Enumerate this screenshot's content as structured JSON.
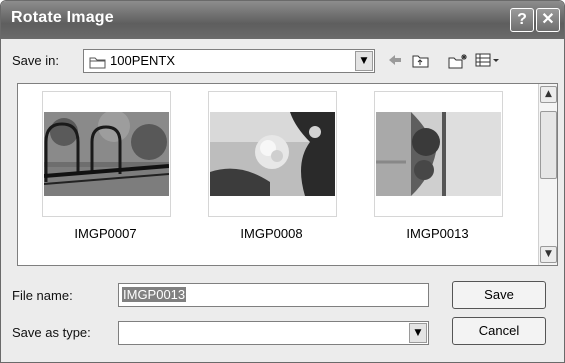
{
  "window": {
    "title": "Rotate Image",
    "help_label": "?",
    "close_label": "✕"
  },
  "save_in": {
    "label": "Save in:",
    "value": "100PENTX"
  },
  "toolbar": {
    "back_icon": "back-arrow-icon",
    "up_icon": "up-folder-icon",
    "new_folder_icon": "new-folder-icon",
    "views_icon": "views-menu-icon"
  },
  "files": [
    {
      "name": "IMGP0007"
    },
    {
      "name": "IMGP0008"
    },
    {
      "name": "IMGP0013"
    }
  ],
  "file_name": {
    "label": "File name:",
    "value": "IMGP0013"
  },
  "save_as_type": {
    "label": "Save as type:",
    "value": ""
  },
  "buttons": {
    "save": "Save",
    "cancel": "Cancel"
  }
}
